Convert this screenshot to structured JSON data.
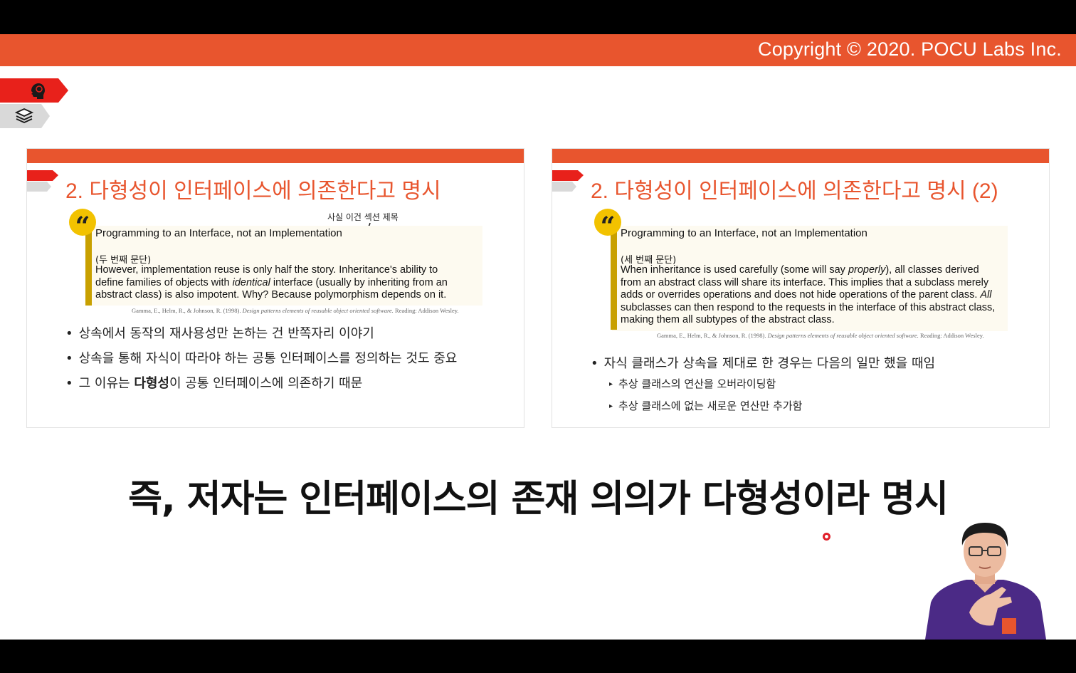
{
  "header": {
    "copyright": "Copyright © 2020. POCU Labs Inc."
  },
  "nav_icons": {
    "top": "brain-head-icon",
    "bottom": "book-stack-icon"
  },
  "slide_left": {
    "title": "2. 다형성이 인터페이스에 의존한다고 명시",
    "annotation": "사실 이건 섹션 제목",
    "quote_heading": "Programming to an Interface, not an Implementation",
    "paragraph_label": "(두 번째 문단)",
    "quote_line1": "However, implementation reuse is only half the story. Inheritance's ability to",
    "quote_line2a": "define families of objects with ",
    "quote_line2_em": "identical",
    "quote_line2b": " interface (usually by inheriting from an",
    "quote_line3": "abstract class) is also impotent. Why? Because polymorphism depends on it.",
    "citation_a": "Gamma, E., Helm, R., & Johnson, R. (1998). ",
    "citation_em": "Design patterns elements of reusable object oriented software.",
    "citation_b": " Reading: Addison Wesley.",
    "bullet1": "상속에서 동작의 재사용성만 논하는 건 반쪽자리 이야기",
    "bullet2": "상속을 통해 자식이 따라야 하는 공통 인터페이스를 정의하는 것도 중요",
    "bullet3a": "그 이유는 ",
    "bullet3_bold": "다형성",
    "bullet3b": "이 공통 인터페이스에 의존하기 때문"
  },
  "slide_right": {
    "title": "2. 다형성이 인터페이스에 의존한다고 명시 (2)",
    "quote_heading": "Programming to an Interface, not an Implementation",
    "paragraph_label": "(세 번째 문단)",
    "quote_line1a": "When inheritance is used carefully (some will say ",
    "quote_line1_em": "properly",
    "quote_line1b": "), all classes derived",
    "quote_line2": "from an abstract class will share its interface. This implies that a subclass merely",
    "quote_line3a": "adds or overrides operations and does not hide operations of the parent class. ",
    "quote_line3_em": "All",
    "quote_line4": "subclasses can then respond to the requests in the interface of this abstract class,",
    "quote_line5": "making them all subtypes of the abstract class.",
    "citation_a": "Gamma, E., Helm, R., & Johnson, R. (1998). ",
    "citation_em": "Design patterns elements of reusable object oriented software.",
    "citation_b": " Reading: Addison Wesley.",
    "bullet1": "자식 클래스가 상속을 제대로 한 경우는 다음의 일만 했을 때임",
    "sub1": "추상 클래스의 연산을 오버라이딩함",
    "sub2": "추상 클래스에 없는 새로운 연산만 추가함"
  },
  "subtitle": "즉, 저자는 인터페이스의 존재 의의가 다형성이라 명시",
  "colors": {
    "accent": "#e8552e",
    "tab_red": "#e8211b",
    "quote_bar": "#c8a000",
    "quote_mark": "#f2c200"
  }
}
